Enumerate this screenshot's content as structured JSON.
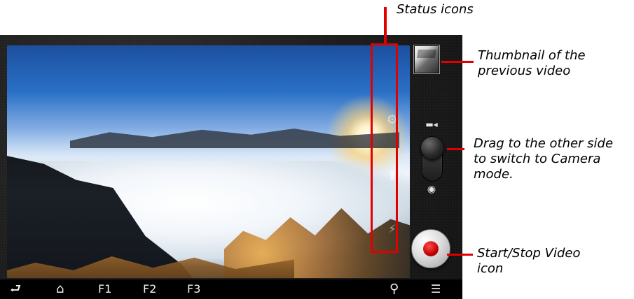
{
  "callouts": {
    "status_icons": "Status icons",
    "thumbnail": [
      "Thumbnail of the",
      "previous video"
    ],
    "switch": [
      "Drag to the other side",
      "to switch to Camera",
      "mode."
    ],
    "record": [
      "Start/Stop Video",
      "icon"
    ]
  },
  "navbar": {
    "items": [
      {
        "label": "⮐",
        "icon": "back-icon"
      },
      {
        "label": "⌂",
        "icon": "home-icon"
      },
      {
        "label": "F1"
      },
      {
        "label": "F2"
      },
      {
        "label": "F3"
      },
      {
        "label": "⚲",
        "icon": "search-icon"
      },
      {
        "label": "☰",
        "icon": "menu-icon"
      }
    ]
  },
  "icons": {
    "status": [
      "settings-gear-icon",
      "camera-icon",
      "flash-icon",
      "white-balance-icon"
    ],
    "mode_switch": [
      "video-mode-icon",
      "camera-mode-icon"
    ],
    "record": "record-icon"
  },
  "colors": {
    "callout_red": "#e00000",
    "record_red": "#c10000",
    "device_frame": "#1d1d1d",
    "navbar": "#000000"
  }
}
